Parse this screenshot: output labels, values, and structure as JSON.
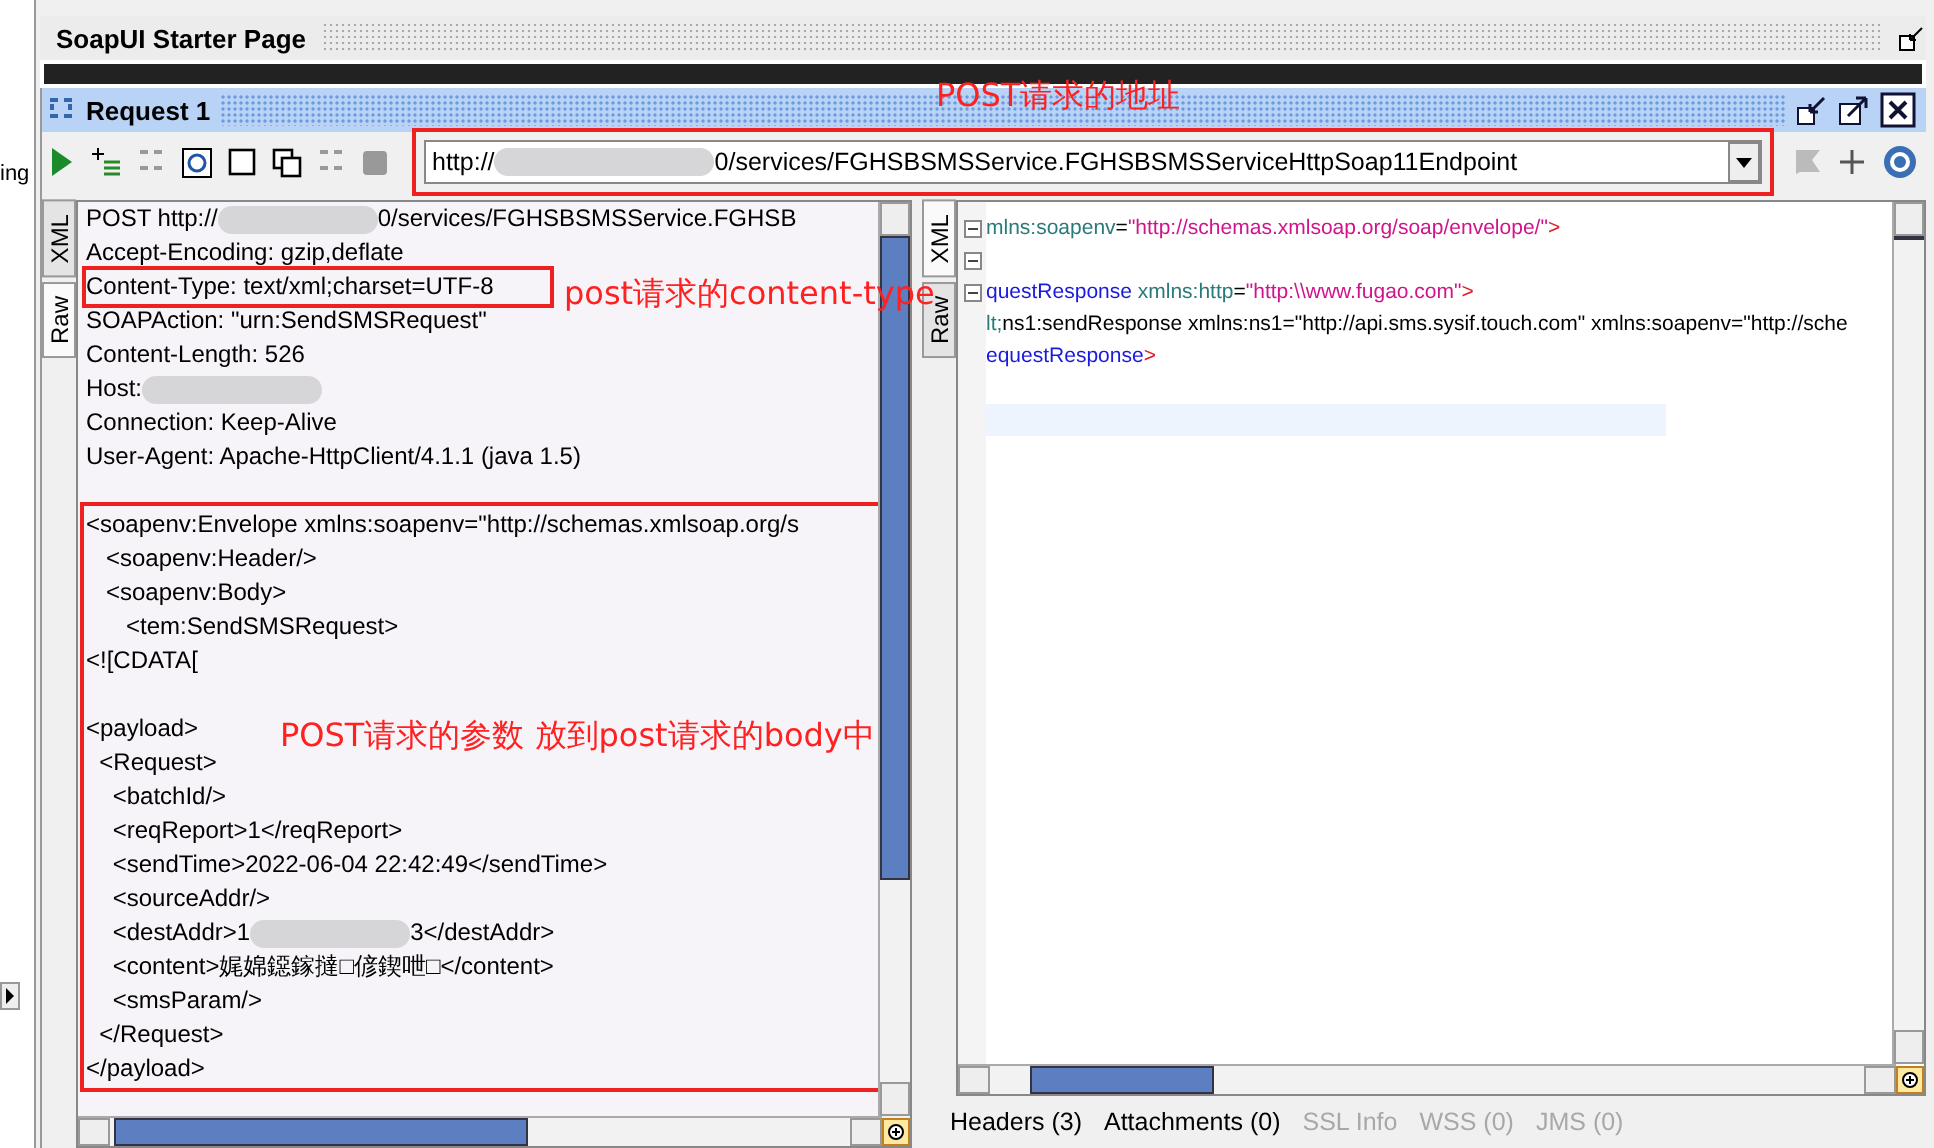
{
  "navigator": {
    "item_label": "ing"
  },
  "starter_tab": {
    "title": "SoapUI Starter Page"
  },
  "request": {
    "title": "Request 1",
    "endpoint": {
      "prefix": "http://",
      "suffix": "0/services/FGHSBSMSService.FGHSBSMSServiceHttpSoap11Endpoint",
      "highlighted": true
    }
  },
  "request_editor": {
    "tabs": [
      {
        "label": "XML",
        "selected": false
      },
      {
        "label": "Raw",
        "selected": true
      }
    ],
    "header_lines": [
      {
        "parts": [
          "POST http://",
          "0/services/FGHSBSMSService.FGHSB"
        ],
        "redacted": true,
        "highlighted": false
      },
      {
        "parts": [
          "Accept-Encoding: gzip,deflate"
        ],
        "redacted": false,
        "highlighted": false
      },
      {
        "parts": [
          "Content-Type: text/xml;charset=UTF-8"
        ],
        "redacted": false,
        "highlighted": true
      },
      {
        "parts": [
          "SOAPAction: \"urn:SendSMSRequest\""
        ],
        "redacted": false,
        "highlighted": false
      },
      {
        "parts": [
          "Content-Length: 526"
        ],
        "redacted": false,
        "highlighted": false
      },
      {
        "parts": [
          "Host:"
        ],
        "redacted": true,
        "highlighted": false
      },
      {
        "parts": [
          "Connection: Keep-Alive"
        ],
        "redacted": false,
        "highlighted": false
      },
      {
        "parts": [
          "User-Agent: Apache-HttpClient/4.1.1 (java 1.5)"
        ],
        "redacted": false,
        "highlighted": false
      }
    ],
    "body_highlighted": true,
    "soap_lines": [
      {
        "parts": [
          "<soapenv:Envelope xmlns:soapenv=\"http://schemas.xmlsoap.org/s"
        ],
        "redacted": false
      },
      {
        "parts": [
          "   <soapenv:Header/>"
        ],
        "redacted": false
      },
      {
        "parts": [
          "   <soapenv:Body>"
        ],
        "redacted": false
      },
      {
        "parts": [
          "      <tem:SendSMSRequest>"
        ],
        "redacted": false
      },
      {
        "parts": [
          "<![CDATA["
        ],
        "redacted": false
      }
    ],
    "payload_lines": [
      {
        "parts": [
          "<payload>"
        ],
        "redacted": false
      },
      {
        "parts": [
          "  <Request>"
        ],
        "redacted": false
      },
      {
        "parts": [
          "    <batchId/>"
        ],
        "redacted": false
      },
      {
        "parts": [
          "    <reqReport>1</reqReport>"
        ],
        "redacted": false
      },
      {
        "parts": [
          "    <sendTime>2022-06-04 22:42:49</sendTime>"
        ],
        "redacted": false
      },
      {
        "parts": [
          "    <sourceAddr/>"
        ],
        "redacted": false
      },
      {
        "parts": [
          "    <destAddr>1",
          "3</destAddr>"
        ],
        "redacted": true
      },
      {
        "parts": [
          "    <content>娓婂鐚鎵撻□偐鍥呭□</content>"
        ],
        "redacted": false
      },
      {
        "parts": [
          "    <smsParam/>"
        ],
        "redacted": false
      },
      {
        "parts": [
          "  </Request>"
        ],
        "redacted": false
      },
      {
        "parts": [
          "</payload>"
        ],
        "redacted": false
      }
    ]
  },
  "response_editor": {
    "tabs": [
      {
        "label": "XML",
        "selected": true
      },
      {
        "label": "Raw",
        "selected": false
      }
    ],
    "lines": [
      {
        "collapsible": true,
        "tokens": [
          {
            "kind": "attr",
            "text": "mlns:soapenv"
          },
          {
            "kind": "punct",
            "text": "="
          },
          {
            "kind": "value",
            "text": "\"http://schemas.xmlsoap.org/soap/envelope/\""
          },
          {
            "kind": "bracket",
            "text": ">"
          }
        ]
      },
      {
        "collapsible": true
      },
      {
        "collapsible": true,
        "tokens": [
          {
            "kind": "tag",
            "text": "questResponse"
          },
          {
            "kind": "attr",
            "text": " xmlns:http"
          },
          {
            "kind": "punct",
            "text": "="
          },
          {
            "kind": "value",
            "text": "\"http:\\\\www.fugao.com\""
          },
          {
            "kind": "bracket",
            "text": ">"
          }
        ]
      },
      {
        "collapsible": false,
        "tokens": [
          {
            "kind": "attr",
            "text": "lt;"
          },
          {
            "kind": "text",
            "text": "ns1:sendResponse xmlns:ns1=\"http://api.sms.sysif.touch.com\" xmlns:soapenv=\"http://sche"
          }
        ]
      },
      {
        "collapsible": false,
        "tokens": [
          {
            "kind": "tag",
            "text": "equestResponse"
          },
          {
            "kind": "bracket",
            "text": ">"
          }
        ]
      }
    ],
    "bottom_tabs": [
      {
        "label": "Headers (3)",
        "disabled": false
      },
      {
        "label": "Attachments (0)",
        "disabled": false
      },
      {
        "label": "SSL Info",
        "disabled": true
      },
      {
        "label": "WSS (0)",
        "disabled": true
      },
      {
        "label": "JMS (0)",
        "disabled": true
      }
    ]
  },
  "annotations": [
    "POST请求的地址",
    "post请求的content-type",
    "POST请求的参数 放到post请求的body中"
  ]
}
